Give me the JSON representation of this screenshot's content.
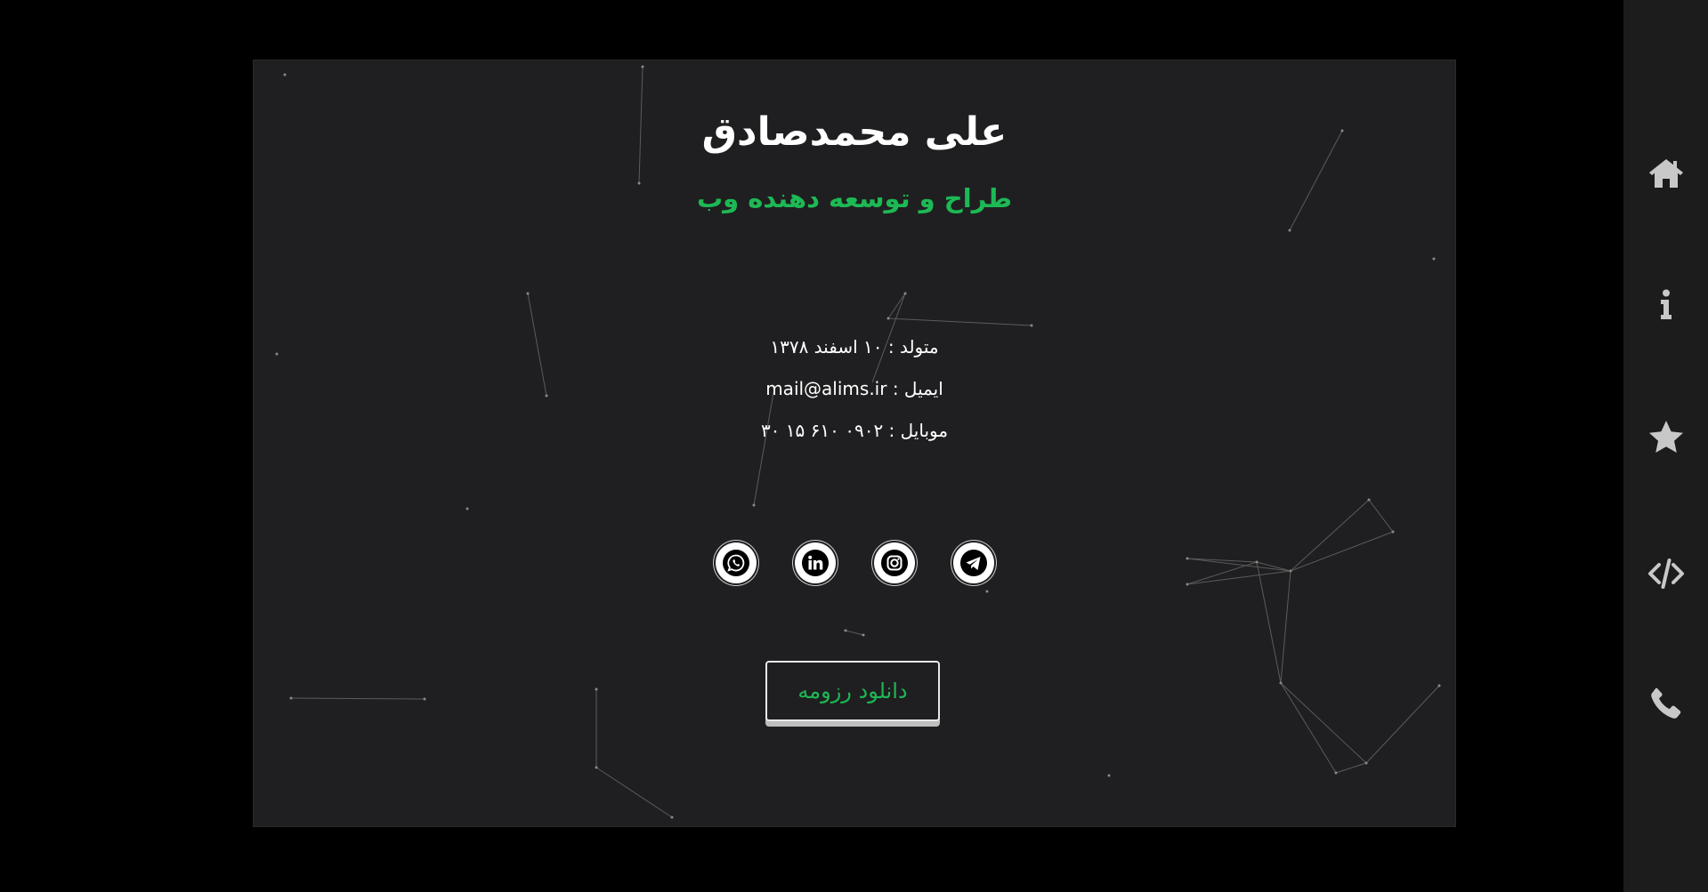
{
  "profile": {
    "name": "علی محمدصادق",
    "title": "طراح و توسعه دهنده وب"
  },
  "info": {
    "birth_label": "متولد :",
    "birth_value": "۱۰ اسفند ۱۳۷۸",
    "email_label": "ایمیل :",
    "email_value": "mail@alims.ir",
    "mobile_label": "موبایل :",
    "mobile_value": "۰۹۰۲ ۶۱۰ ۱۵ ۳۰"
  },
  "socials": [
    {
      "name": "telegram-icon"
    },
    {
      "name": "instagram-icon"
    },
    {
      "name": "linkedin-icon"
    },
    {
      "name": "whatsapp-icon"
    }
  ],
  "resume_button": {
    "label": "دانلود رزومه"
  },
  "sidebar": {
    "items": [
      {
        "icon": "home-icon"
      },
      {
        "icon": "info-icon"
      },
      {
        "icon": "star-icon"
      },
      {
        "icon": "code-icon"
      },
      {
        "icon": "phone-icon"
      }
    ]
  },
  "colors": {
    "page_background": "#000000",
    "card_background": "#1f1f21",
    "accent_green": "#1db954",
    "text_white": "#ffffff",
    "icon_gray": "#c8c8c8",
    "sidebar_background": "#1c1c1c"
  }
}
